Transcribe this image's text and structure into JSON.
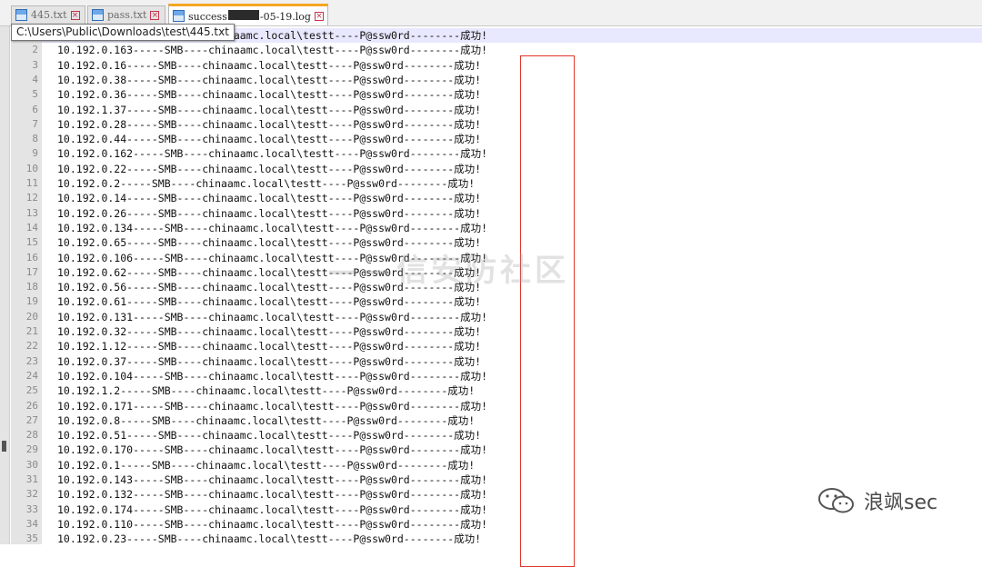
{
  "tabs": [
    {
      "name": "445.txt",
      "active": false
    },
    {
      "name": "pass.txt",
      "active": false
    },
    {
      "name_prefix": "success",
      "name_suffix": "-05-19.log",
      "active": true
    }
  ],
  "tooltip": "C:\\Users\\Public\\Downloads\\test\\445.txt",
  "lines": [
    {
      "n": "1",
      "text": "10.192.0.■■■-----SMB----chinaamc.local\\testt----P@ssw0rd--------成功!"
    },
    {
      "n": "2",
      "text": "10.192.0.163-----SMB----chinaamc.local\\testt----P@ssw0rd--------成功!"
    },
    {
      "n": "3",
      "text": "10.192.0.16-----SMB----chinaamc.local\\testt----P@ssw0rd--------成功!"
    },
    {
      "n": "4",
      "text": "10.192.0.38-----SMB----chinaamc.local\\testt----P@ssw0rd--------成功!"
    },
    {
      "n": "5",
      "text": "10.192.0.36-----SMB----chinaamc.local\\testt----P@ssw0rd--------成功!"
    },
    {
      "n": "6",
      "text": "10.192.1.37-----SMB----chinaamc.local\\testt----P@ssw0rd--------成功!"
    },
    {
      "n": "7",
      "text": "10.192.0.28-----SMB----chinaamc.local\\testt----P@ssw0rd--------成功!"
    },
    {
      "n": "8",
      "text": "10.192.0.44-----SMB----chinaamc.local\\testt----P@ssw0rd--------成功!"
    },
    {
      "n": "9",
      "text": "10.192.0.162-----SMB----chinaamc.local\\testt----P@ssw0rd--------成功!"
    },
    {
      "n": "10",
      "text": "10.192.0.22-----SMB----chinaamc.local\\testt----P@ssw0rd--------成功!"
    },
    {
      "n": "11",
      "text": "10.192.0.2-----SMB----chinaamc.local\\testt----P@ssw0rd--------成功!"
    },
    {
      "n": "12",
      "text": "10.192.0.14-----SMB----chinaamc.local\\testt----P@ssw0rd--------成功!"
    },
    {
      "n": "13",
      "text": "10.192.0.26-----SMB----chinaamc.local\\testt----P@ssw0rd--------成功!"
    },
    {
      "n": "14",
      "text": "10.192.0.134-----SMB----chinaamc.local\\testt----P@ssw0rd--------成功!"
    },
    {
      "n": "15",
      "text": "10.192.0.65-----SMB----chinaamc.local\\testt----P@ssw0rd--------成功!"
    },
    {
      "n": "16",
      "text": "10.192.0.106-----SMB----chinaamc.local\\testt----P@ssw0rd--------成功!"
    },
    {
      "n": "17",
      "text": "10.192.0.62-----SMB----chinaamc.local\\testt----P@ssw0rd--------成功!"
    },
    {
      "n": "18",
      "text": "10.192.0.56-----SMB----chinaamc.local\\testt----P@ssw0rd--------成功!"
    },
    {
      "n": "19",
      "text": "10.192.0.61-----SMB----chinaamc.local\\testt----P@ssw0rd--------成功!"
    },
    {
      "n": "20",
      "text": "10.192.0.131-----SMB----chinaamc.local\\testt----P@ssw0rd--------成功!"
    },
    {
      "n": "21",
      "text": "10.192.0.32-----SMB----chinaamc.local\\testt----P@ssw0rd--------成功!"
    },
    {
      "n": "22",
      "text": "10.192.1.12-----SMB----chinaamc.local\\testt----P@ssw0rd--------成功!"
    },
    {
      "n": "23",
      "text": "10.192.0.37-----SMB----chinaamc.local\\testt----P@ssw0rd--------成功!"
    },
    {
      "n": "24",
      "text": "10.192.0.104-----SMB----chinaamc.local\\testt----P@ssw0rd--------成功!"
    },
    {
      "n": "25",
      "text": "10.192.1.2-----SMB----chinaamc.local\\testt----P@ssw0rd--------成功!"
    },
    {
      "n": "26",
      "text": "10.192.0.171-----SMB----chinaamc.local\\testt----P@ssw0rd--------成功!"
    },
    {
      "n": "27",
      "text": "10.192.0.8-----SMB----chinaamc.local\\testt----P@ssw0rd--------成功!"
    },
    {
      "n": "28",
      "text": "10.192.0.51-----SMB----chinaamc.local\\testt----P@ssw0rd--------成功!"
    },
    {
      "n": "29",
      "text": "10.192.0.170-----SMB----chinaamc.local\\testt----P@ssw0rd--------成功!"
    },
    {
      "n": "30",
      "text": "10.192.0.1-----SMB----chinaamc.local\\testt----P@ssw0rd--------成功!"
    },
    {
      "n": "31",
      "text": "10.192.0.143-----SMB----chinaamc.local\\testt----P@ssw0rd--------成功!"
    },
    {
      "n": "32",
      "text": "10.192.0.132-----SMB----chinaamc.local\\testt----P@ssw0rd--------成功!"
    },
    {
      "n": "33",
      "text": "10.192.0.174-----SMB----chinaamc.local\\testt----P@ssw0rd--------成功!"
    },
    {
      "n": "34",
      "text": "10.192.0.110-----SMB----chinaamc.local\\testt----P@ssw0rd--------成功!"
    },
    {
      "n": "35",
      "text": "10.192.0.23-----SMB----chinaamc.local\\testt----P@ssw0rd--------成功!"
    }
  ],
  "watermark": "——信安防社区",
  "brand": {
    "name": "浪飒sec",
    "icon": "wechat-icon"
  },
  "colors": {
    "highlight_box": "#e0352b",
    "active_tab_accent": "#f5a623"
  }
}
